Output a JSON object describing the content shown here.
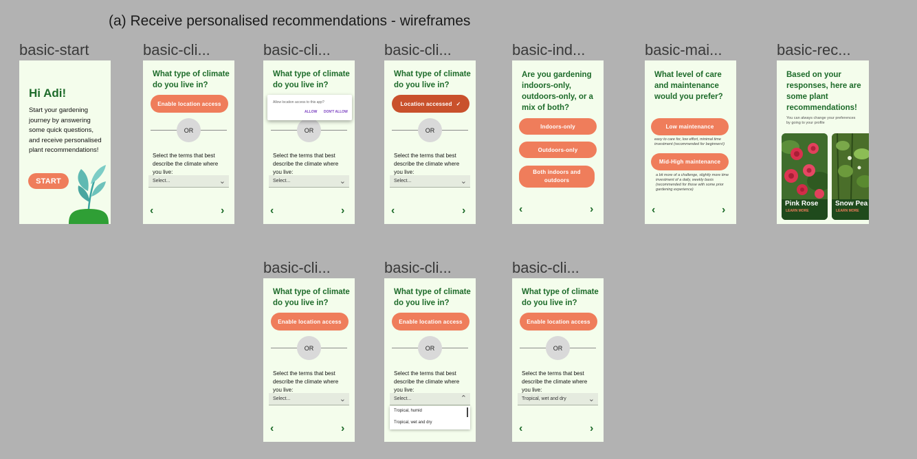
{
  "heading": "(a) Receive personalised recommendations - wireframes",
  "labels": {
    "start": "basic-start",
    "cli": "basic-cli...",
    "ind": "basic-ind...",
    "mai": "basic-mai...",
    "rec": "basic-rec..."
  },
  "start": {
    "greeting": "Hi Adi!",
    "body": "Start your gardening journey by answering some quick questions, and receive personalised plant recommendations!",
    "button": "START"
  },
  "climate": {
    "question": "What type of climate do you live in?",
    "enable_location": "Enable location access",
    "location_accessed": "Location accessed",
    "or": "OR",
    "terms": "Select the terms that best describe the climate where you live:",
    "placeholder": "Select...",
    "selected_value": "Tropical, wet and dry",
    "options": [
      "Tropical, humid",
      "Tropical, wet and dry"
    ],
    "dialog_text": "Allow location access to this app?",
    "dialog_allow": "ALLOW",
    "dialog_deny": "DON'T ALLOW"
  },
  "indoor": {
    "question": "Are you gardening indoors-only, outdoors-only, or a mix of both?",
    "opt1": "Indoors-only",
    "opt2": "Outdoors-only",
    "opt3": "Both indoors and outdoors"
  },
  "maint": {
    "question": "What level of care and maintenance would you prefer?",
    "low": "Low maintenance",
    "low_desc": "easy to care for, low effort, minimal time investment (recommended for beginners!)",
    "high": "Mid-High maintenance",
    "high_desc": "a bit more of a challenge, slightly more time investment of a daily, weekly basis (recommended for those with some prior gardening experience)"
  },
  "rec": {
    "intro": "Based on your responses, here are some plant recommendations!",
    "note": "You can always change your preferences by going to your profile",
    "card1_name": "Pink Rose",
    "card2_name": "Snow Pea",
    "learn_more": "LEARN MORE"
  },
  "nav": {
    "prev": "‹",
    "next": "›"
  },
  "colors": {
    "primary": "#ef7d5b",
    "accent_green": "#1d6b2a",
    "background": "#f4fdec"
  }
}
